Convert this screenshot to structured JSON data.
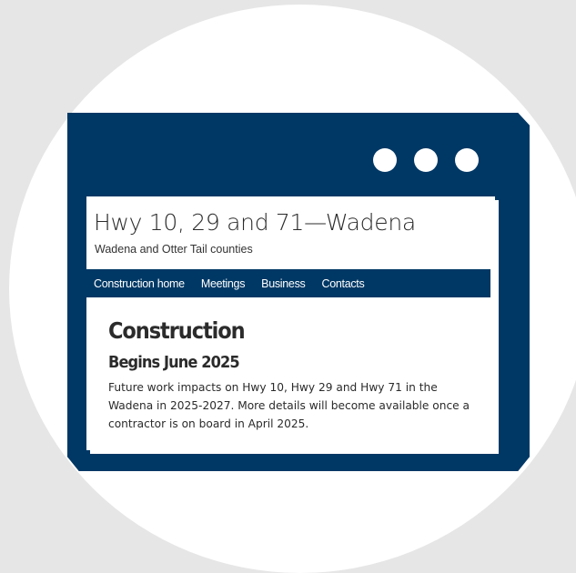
{
  "window": {
    "controls": [
      "window-dot",
      "window-dot",
      "window-dot"
    ]
  },
  "site": {
    "title": "Hwy 10, 29 and 71—Wadena",
    "subtitle": "Wadena and Otter Tail counties"
  },
  "nav": {
    "items": [
      {
        "label": "Construction home"
      },
      {
        "label": "Meetings"
      },
      {
        "label": "Business"
      },
      {
        "label": "Contacts"
      }
    ]
  },
  "content": {
    "heading": "Construction",
    "subheading": "Begins June 2025",
    "body": "Future work impacts on Hwy 10, Hwy 29 and Hwy 71 in the Wadena in 2025-2027. More details will become available once a contractor is on board in April 2025."
  },
  "colors": {
    "brand_navy": "#003865",
    "background": "#e6e6e6",
    "circle": "#ffffff"
  }
}
